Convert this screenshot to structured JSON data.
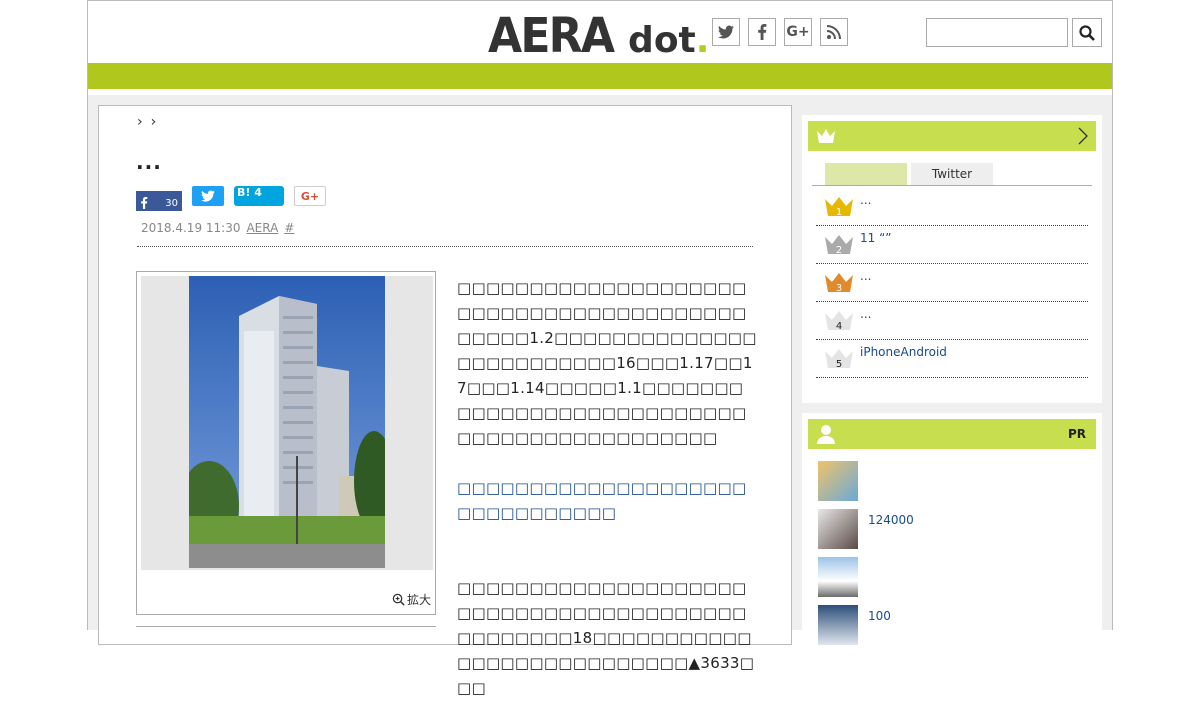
{
  "header": {
    "logo_main": "AERA",
    "logo_sub": "dot",
    "social_icons": [
      "twitter-icon",
      "facebook-icon",
      "google-plus-icon",
      "rss-icon"
    ],
    "search_placeholder": ""
  },
  "breadcrumb": [
    "›",
    "›"
  ],
  "article": {
    "title": "...",
    "share": {
      "facebook_count": "30",
      "hatena_count": "4"
    },
    "meta": {
      "date": "2018.4.19 11:30",
      "author": "AERA",
      "hash": "#"
    },
    "photo_zoom_label": "拡大",
    "body": {
      "p1": "□□□□□□□□□□□□□□□□□□□□□□□□□□□□□□□□□□□□□□□□□□□□□1.2□□□□□□□□□□□□□□□□□□□□□□□□□16□□□1.17□□17□□□1.14□□□□□1.1□□□□□□□□□□□□□□□□□□□□□□□□□□□□□□□□□□□□□□□□□□□□□",
      "link": "□□□□□□□□□□□□□□□□□□□□□□□□□□□□□□□",
      "p2": "□□□□□□□□□□□□□□□□□□□□□□□□□□□□□□□□□□□□□□□□□□□□□□□□18□□□□□□□□□□□□□□□□□□□□□□□□□□□▲3633□□□"
    }
  },
  "ranking": {
    "tab_active": "",
    "tab_other": "Twitter",
    "items": [
      {
        "rank": "1",
        "text": "...",
        "color": "#e6b800"
      },
      {
        "rank": "2",
        "text": "11 “”",
        "color": "#aaaaaa"
      },
      {
        "rank": "3",
        "text": "...",
        "color": "#e08a2c"
      },
      {
        "rank": "4",
        "text": "...",
        "color": "#dddddd"
      },
      {
        "rank": "5",
        "text": "iPhoneAndroid",
        "color": "#dddddd"
      }
    ]
  },
  "pr": {
    "label": "PR",
    "items": [
      {
        "text": ""
      },
      {
        "text": "124000"
      },
      {
        "text": ""
      },
      {
        "text": "100"
      }
    ]
  },
  "colors": {
    "brand_green": "#b0c81e",
    "sidebar_green": "#c7df4f"
  }
}
